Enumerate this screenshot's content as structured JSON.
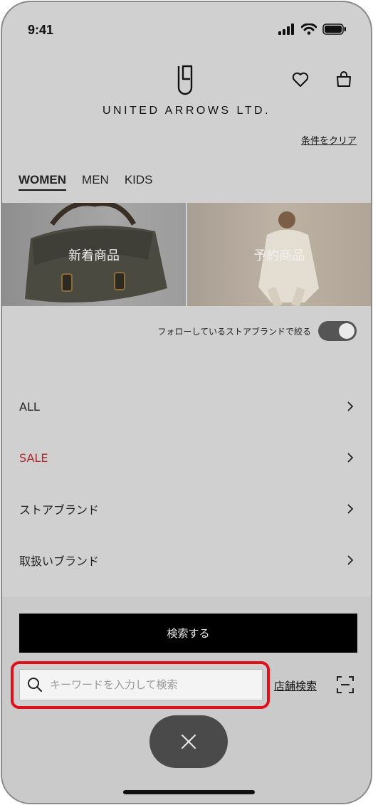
{
  "status": {
    "time": "9:41"
  },
  "brand": {
    "name": "UNITED ARROWS LTD."
  },
  "header": {
    "clear_label": "条件をクリア"
  },
  "tabs": [
    {
      "label": "WOMEN",
      "active": true
    },
    {
      "label": "MEN",
      "active": false
    },
    {
      "label": "KIDS",
      "active": false
    }
  ],
  "banners": [
    {
      "label": "新着商品"
    },
    {
      "label": "予約商品"
    }
  ],
  "follow_toggle": {
    "label": "フォローしているストアブランドで絞る",
    "on": true
  },
  "menu": [
    {
      "label": "ALL"
    },
    {
      "label": "SALE",
      "color": "#b3262f"
    },
    {
      "label": "ストアブランド"
    },
    {
      "label": "取扱いブランド"
    }
  ],
  "search": {
    "button_label": "検索する",
    "placeholder": "キーワードを入力して検索",
    "value": "",
    "store_search_label": "店舗検索"
  },
  "colors": {
    "accent_highlight": "#e0101a",
    "sale": "#b3262f"
  }
}
